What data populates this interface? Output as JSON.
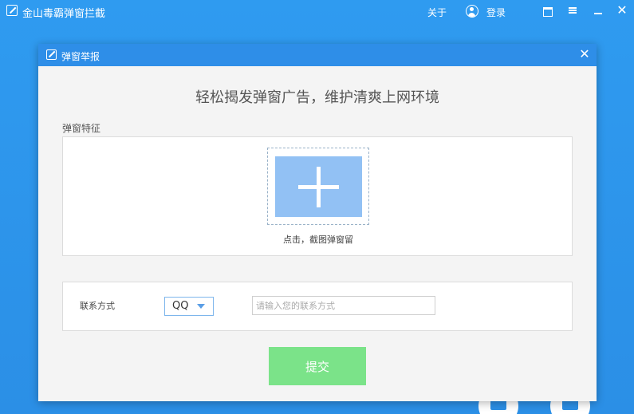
{
  "app": {
    "title": "金山毒霸弹窗拦截",
    "about_label": "关于",
    "login_label": "登录",
    "close_glyph": "✕"
  },
  "dialog": {
    "title": "弹窗举报",
    "close_glyph": "✕",
    "slogan": "轻松揭发弹窗广告，维护清爽上网环境",
    "feature_section_label": "弹窗特征",
    "capture_hint": "点击，截图弹窗留",
    "contact": {
      "label": "联系方式",
      "selected_option": "QQ",
      "input_value": "",
      "input_placeholder": "请输入您的联系方式"
    },
    "submit_label": "提交"
  },
  "colors": {
    "background": "#2f9bf0",
    "dialog_header": "#2e8ee8",
    "capture_box": "#92c1f4",
    "submit_button": "#7be389"
  },
  "icons": {
    "app_logo": "app-logo-icon",
    "user": "user-icon",
    "skin": "skin-icon",
    "menu": "menu-icon",
    "minimize": "minimize-icon",
    "close": "close-icon",
    "plus": "plus-icon",
    "dropdown": "chevron-down-icon"
  }
}
